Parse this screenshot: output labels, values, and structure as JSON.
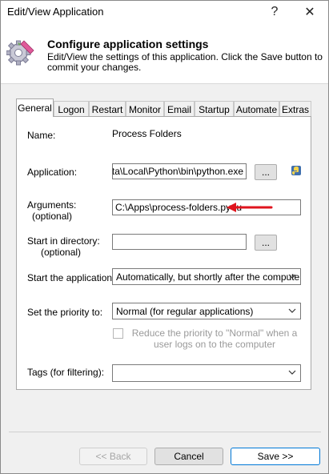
{
  "window": {
    "title": "Edit/View Application",
    "help_label": "?",
    "close_label": "✕"
  },
  "header": {
    "heading": "Configure application settings",
    "description": "Edit/View the settings of this application. Click the Save button to commit your changes."
  },
  "tabs": [
    "General",
    "Logon",
    "Restart",
    "Monitor",
    "Email",
    "Startup",
    "Automate",
    "Extras"
  ],
  "form": {
    "name_label": "Name:",
    "name_value": "Process Folders",
    "application_label": "Application:",
    "application_value": "ata\\Local\\Python\\bin\\python.exe",
    "browse_label": "...",
    "arguments_label": "Arguments:",
    "arguments_optional": "(optional)",
    "arguments_value": "C:\\Apps\\process-folders.py -u",
    "startdir_label": "Start in directory:",
    "startdir_optional": "(optional)",
    "startdir_value": "",
    "start_app_label": "Start the application:",
    "start_app_value": "Automatically, but shortly after the computer b",
    "priority_label": "Set the priority to:",
    "priority_value": "Normal (for regular applications)",
    "reduce_priority_label": "Reduce the priority to \"Normal\" when a user logs on to the computer",
    "tags_label": "Tags (for filtering):",
    "tags_value": ""
  },
  "footer": {
    "back_label": "<< Back",
    "cancel_label": "Cancel",
    "save_label": "Save >>"
  },
  "colors": {
    "arrow": "#e0141e",
    "default_button_border": "#0078d7"
  }
}
